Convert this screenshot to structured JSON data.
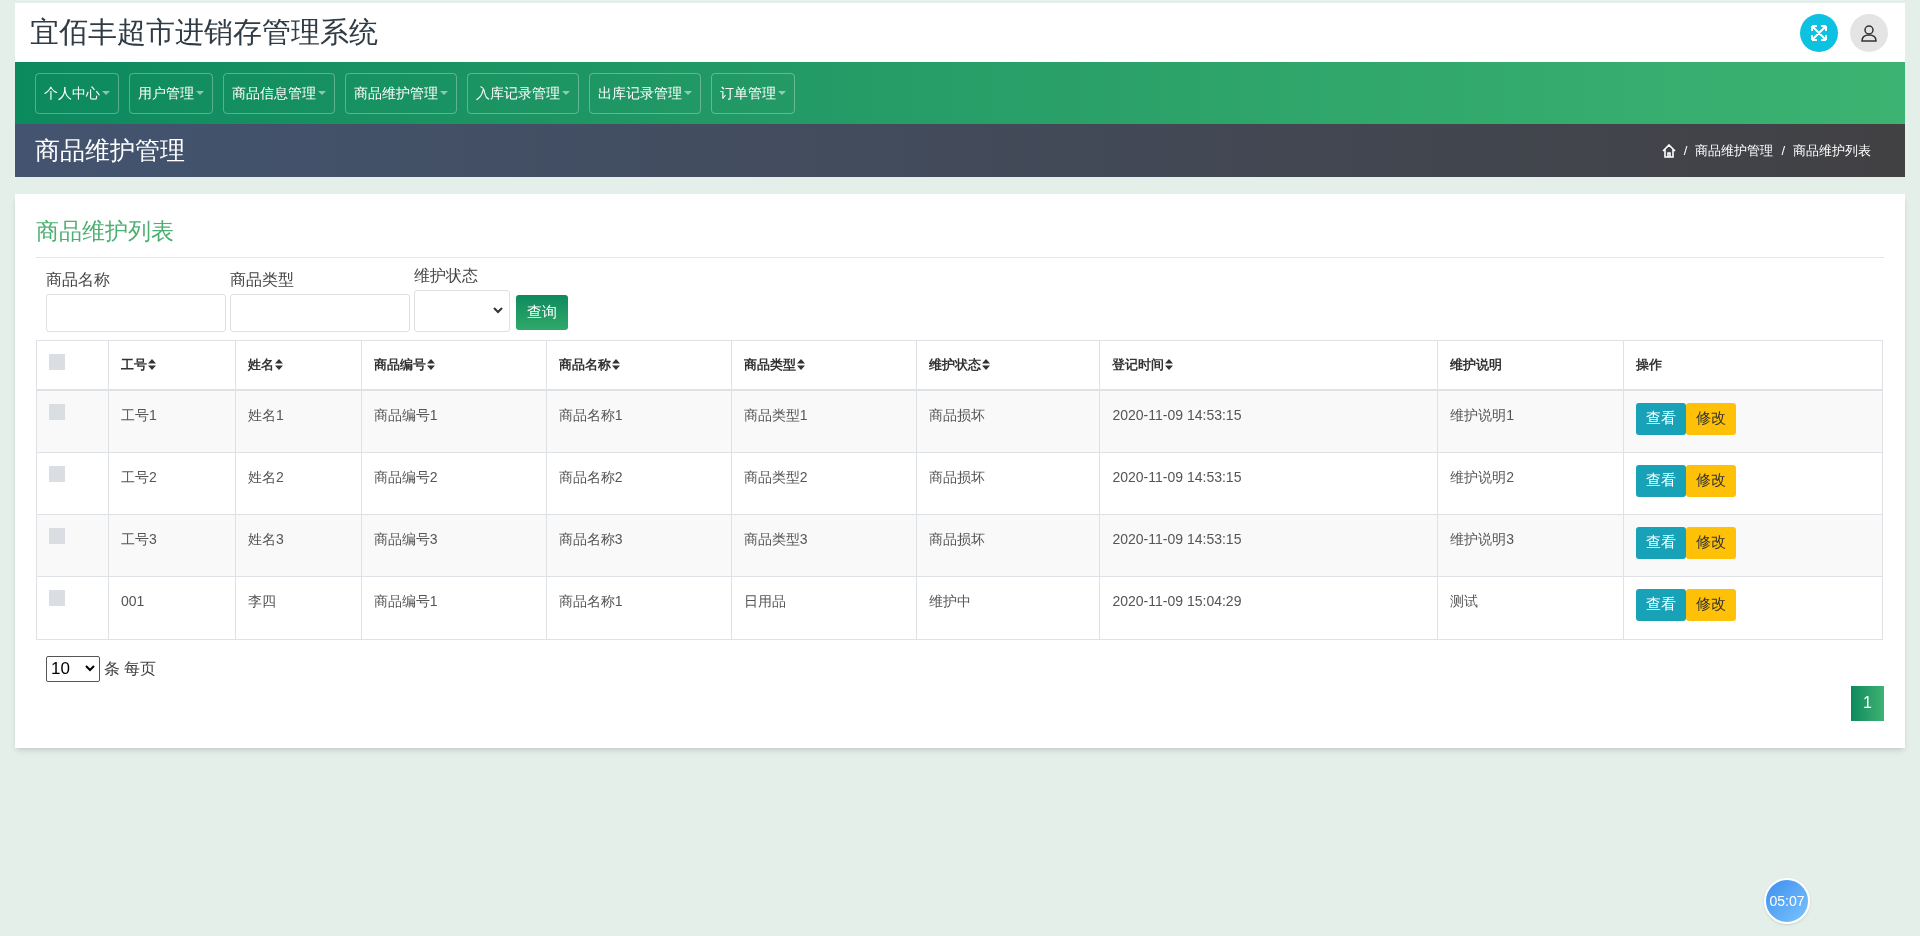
{
  "header": {
    "title": "宜佰丰超市进销存管理系统"
  },
  "nav": [
    {
      "label": "个人中心",
      "selected": false
    },
    {
      "label": "用户管理",
      "selected": false
    },
    {
      "label": "商品信息管理",
      "selected": false
    },
    {
      "label": "商品维护管理",
      "selected": false
    },
    {
      "label": "入库记录管理",
      "selected": false
    },
    {
      "label": "出库记录管理",
      "selected": false
    },
    {
      "label": "订单管理",
      "selected": false
    }
  ],
  "page_title": "商品维护管理",
  "breadcrumb": [
    {
      "separator": "/",
      "label": "商品维护管理"
    },
    {
      "separator": "/",
      "label": "商品维护列表"
    }
  ],
  "card_title": "商品维护列表",
  "filters": [
    {
      "kind": "text",
      "label": "商品名称"
    },
    {
      "kind": "text",
      "label": "商品类型"
    },
    {
      "kind": "select",
      "label": "维护状态"
    }
  ],
  "search_button": "查询",
  "table": {
    "select_all_checked": false,
    "columns": [
      {
        "label": "工号",
        "sortable": true
      },
      {
        "label": "姓名",
        "sortable": true
      },
      {
        "label": "商品编号",
        "sortable": true
      },
      {
        "label": "商品名称",
        "sortable": true
      },
      {
        "label": "商品类型",
        "sortable": true
      },
      {
        "label": "维护状态",
        "sortable": true
      },
      {
        "label": "登记时间",
        "sortable": true
      },
      {
        "label": "维护说明",
        "sortable": false
      },
      {
        "label": "操作",
        "sortable": false
      }
    ],
    "rows": [
      {
        "checked": false,
        "cells": [
          "工号1",
          "姓名1",
          "商品编号1",
          "商品名称1",
          "商品类型1",
          "商品损坏",
          "2020-11-09 14:53:15",
          "维护说明1"
        ],
        "actions": [
          "查看",
          "修改"
        ]
      },
      {
        "checked": false,
        "cells": [
          "工号2",
          "姓名2",
          "商品编号2",
          "商品名称2",
          "商品类型2",
          "商品损坏",
          "2020-11-09 14:53:15",
          "维护说明2"
        ],
        "actions": [
          "查看",
          "修改"
        ]
      },
      {
        "checked": false,
        "cells": [
          "工号3",
          "姓名3",
          "商品编号3",
          "商品名称3",
          "商品类型3",
          "商品损坏",
          "2020-11-09 14:53:15",
          "维护说明3"
        ],
        "actions": [
          "查看",
          "修改"
        ]
      },
      {
        "checked": false,
        "cells": [
          "001",
          "李四",
          "商品编号1",
          "商品名称1",
          "日用品",
          "维护中",
          "2020-11-09 15:04:29",
          "测试"
        ],
        "actions": [
          "查看",
          "修改"
        ]
      }
    ]
  },
  "page_size": {
    "value": "10",
    "suffix": "条 每页"
  },
  "pagination": [
    {
      "label": "1",
      "selected": true
    }
  ],
  "timer": "05:07"
}
